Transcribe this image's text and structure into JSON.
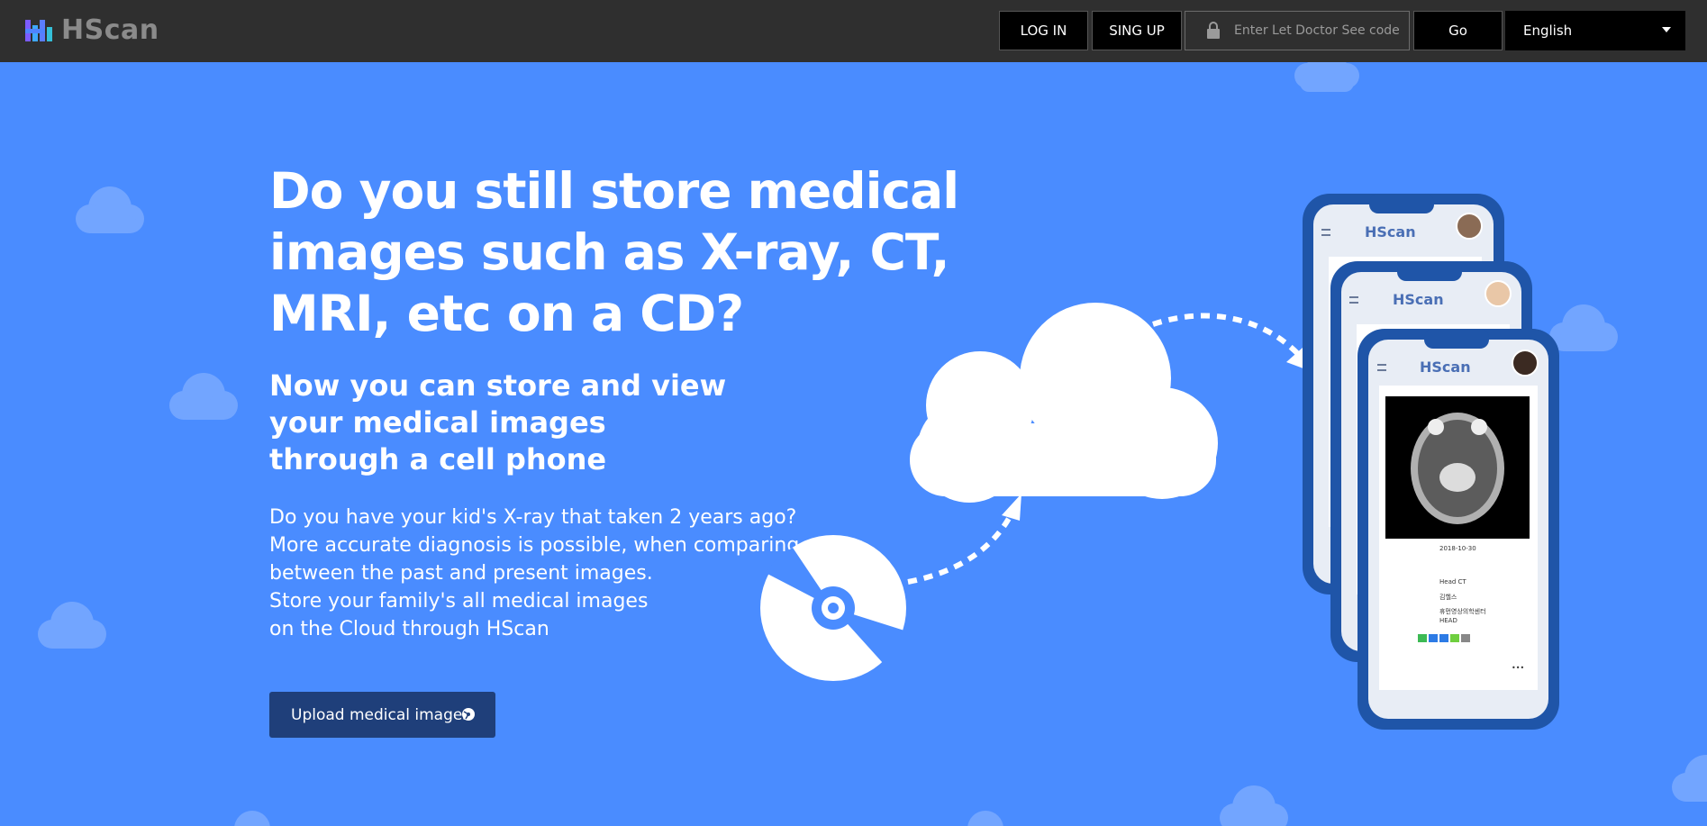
{
  "header": {
    "brand": "HScan",
    "login_label": "LOG IN",
    "signup_label": "SING UP",
    "code_placeholder": "Enter Let Doctor See code",
    "go_label": "Go",
    "language": "English"
  },
  "hero": {
    "headline": "Do you still store medical images such as X-ray, CT, MRI, etc on a CD?",
    "subhead": "Now you can store and view\nyour medical images\nthrough a cell phone",
    "paragraph": [
      "Do you have your kid's X-ray that taken 2 years ago?",
      "More accurate diagnosis is possible, when comparing",
      "between the past and present images.",
      "Store your family's all medical images",
      "on the Cloud through HScan"
    ],
    "upload_label": "Upload medical images"
  },
  "phones": {
    "app_name": "HScan",
    "date": "2018-10-30",
    "exam": "Head CT",
    "patient": "김헬스",
    "hospital": "휴먼영상의학센터",
    "body_part": "HEAD",
    "more": "•••"
  },
  "colors": {
    "background": "#4a8cff",
    "header": "#2f2f2f",
    "upload_button": "#1f3f7a",
    "phone_frame": "#1f55a8"
  },
  "icons": [
    "brand-logo-icon",
    "lock-icon",
    "chevron-down-icon",
    "disc-icon",
    "cloud-icon",
    "dashed-arrow-icon",
    "menu-icon",
    "avatar-icon"
  ]
}
